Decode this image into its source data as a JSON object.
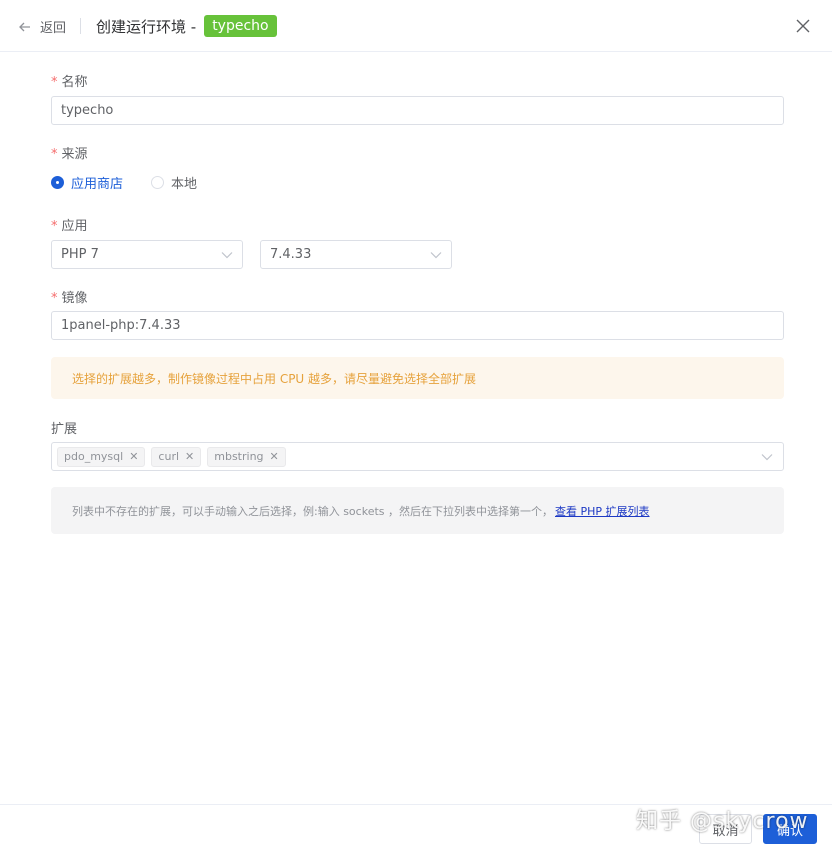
{
  "header": {
    "back_label": "返回",
    "title": "创建运行环境 -",
    "tag": "typecho"
  },
  "form": {
    "name": {
      "label": "名称",
      "value": "typecho"
    },
    "source": {
      "label": "来源",
      "options": [
        {
          "label": "应用商店",
          "checked": true
        },
        {
          "label": "本地",
          "checked": false
        }
      ]
    },
    "app": {
      "label": "应用",
      "app_value": "PHP 7",
      "version_value": "7.4.33"
    },
    "image": {
      "label": "镜像",
      "value": "1panel-php:7.4.33"
    },
    "warning": "选择的扩展越多，制作镜像过程中占用 CPU 越多，请尽量避免选择全部扩展",
    "extensions": {
      "label": "扩展",
      "items": [
        "pdo_mysql",
        "curl",
        "mbstring"
      ]
    },
    "info_text": "列表中不存在的扩展，可以手动输入之后选择，例:输入 sockets ，然后在下拉列表中选择第一个，",
    "info_link": "查看 PHP 扩展列表"
  },
  "footer": {
    "cancel_label": "取消",
    "confirm_label": "确认"
  },
  "watermark": "知乎 @skycrow",
  "colors": {
    "primary": "#1d5fd8",
    "tag_green": "#67c23a",
    "required_red": "#f56c6c",
    "warning_text": "#e6a23c",
    "warning_bg": "#fdf6ec"
  },
  "icons": {
    "back": "arrow-left-icon",
    "close": "close-icon",
    "dropdown": "chevron-down-icon",
    "chip_remove": "close-icon"
  }
}
